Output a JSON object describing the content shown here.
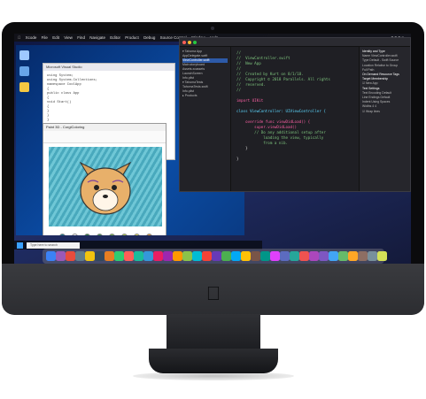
{
  "menubar": {
    "items": [
      "Xcode",
      "File",
      "Edit",
      "View",
      "Find",
      "Navigate",
      "Editor",
      "Product",
      "Debug",
      "Source Control",
      "Window",
      "Help"
    ],
    "status": "■ ■ ■ ≡"
  },
  "windows": {
    "vs_title": "Microsoft Visual Studio",
    "vs_code": [
      "using System;",
      "using System.Collections;",
      "namespace CoolApp",
      "{",
      "  public class App",
      "  {",
      "    void Start()",
      "    {",
      "    }",
      "  }",
      "}"
    ],
    "paint_title": "Paint 3D - CorgiColoring",
    "search_placeholder": "Type here to search"
  },
  "xcode": {
    "nav_items": [
      "▾ Tahoma App",
      "  AppDelegate.swift",
      "  ViewController.swift",
      "  Main.storyboard",
      "  Assets.xcassets",
      "  LaunchScreen",
      "  Info.plist",
      "▾ TahomaTests",
      "  TahomaTests.swift",
      "  Info.plist",
      "▸ Products"
    ],
    "code_lines": [
      {
        "cls": "cmt",
        "text": "//"
      },
      {
        "cls": "cmt",
        "text": "//  ViewController.swift"
      },
      {
        "cls": "cmt",
        "text": "//  New App"
      },
      {
        "cls": "cmt",
        "text": "//"
      },
      {
        "cls": "cmt",
        "text": "//  Created by Kurt on 8/1/18."
      },
      {
        "cls": "cmt",
        "text": "//  Copyright © 2018 Parallels. All rights"
      },
      {
        "cls": "cmt",
        "text": "//  reserved."
      },
      {
        "cls": "cmt",
        "text": "//"
      },
      {
        "cls": "",
        "text": ""
      },
      {
        "cls": "kw",
        "text": "import UIKit"
      },
      {
        "cls": "",
        "text": ""
      },
      {
        "cls": "ty",
        "text": "class ViewController: UIViewController {"
      },
      {
        "cls": "",
        "text": ""
      },
      {
        "cls": "kw",
        "text": "    override func viewDidLoad() {"
      },
      {
        "cls": "kw",
        "text": "        super.viewDidLoad()"
      },
      {
        "cls": "cmt",
        "text": "        // Do any additional setup after"
      },
      {
        "cls": "cmt",
        "text": "            loading the view, typically"
      },
      {
        "cls": "cmt",
        "text": "            from a nib."
      },
      {
        "cls": "",
        "text": "    }"
      },
      {
        "cls": "",
        "text": ""
      },
      {
        "cls": "",
        "text": "}"
      }
    ],
    "inspector_items": [
      "Identity and Type",
      "Name  ViewController.swift",
      "Type  Default - Swift Source",
      "Location  Relative to Group",
      "Full Path",
      "On Demand Resource Tags",
      "Target Membership",
      "  ☑ New App",
      "Text Settings",
      "Text Encoding  Default",
      "Line Endings  Default",
      "Indent Using  Spaces",
      "Widths  4  4",
      "  ☑ Wrap lines"
    ]
  },
  "palette": [
    "#1b7f8f",
    "#ffffff",
    "#2e8a3e",
    "#3f9b4b",
    "#7cbf4a",
    "#b9d94a",
    "#e6e05a",
    "#f0a030"
  ],
  "dock_colors": [
    "#3b82f6",
    "#9b59b6",
    "#e74c3c",
    "#607d8b",
    "#f1c40f",
    "#34495e",
    "#e67e22",
    "#2ecc71",
    "#ff5e57",
    "#1abc9c",
    "#3498db",
    "#e91e63",
    "#9c27b0",
    "#ff9800",
    "#8bc34a",
    "#00bcd4",
    "#f44336",
    "#673ab7",
    "#4caf50",
    "#03a9f4",
    "#ffc107",
    "#795548",
    "#009688",
    "#e040fb",
    "#5c6bc0",
    "#26a69a",
    "#ef5350",
    "#ab47bc",
    "#7e57c2",
    "#42a5f5",
    "#66bb6a",
    "#ffa726",
    "#8d6e63",
    "#78909c",
    "#d4e157"
  ]
}
